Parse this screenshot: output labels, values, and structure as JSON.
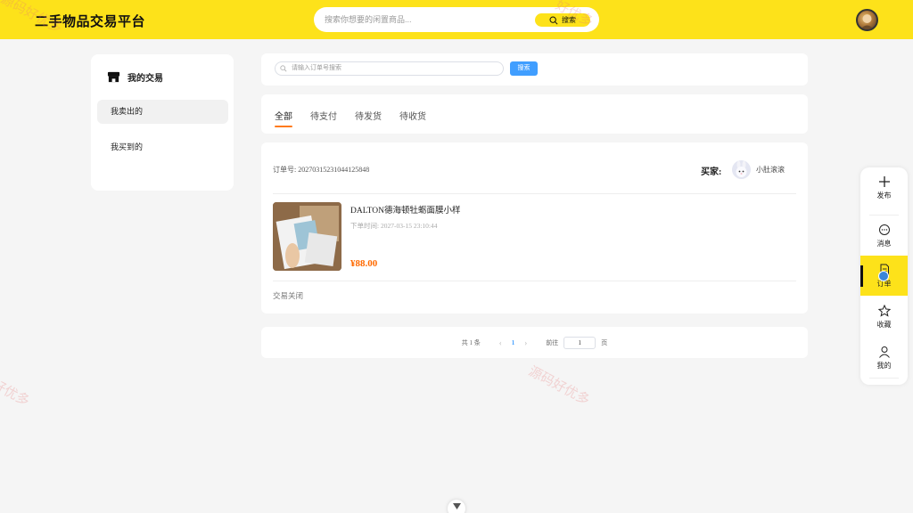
{
  "header": {
    "site_title": "二手物品交易平台",
    "search_placeholder": "搜索你想要的闲置商品...",
    "search_button": "搜索"
  },
  "watermarks": [
    "源码好优多",
    "好优多",
    "好优多",
    "源码好优多"
  ],
  "sidebar": {
    "title": "我的交易",
    "items": [
      {
        "label": "我卖出的",
        "active": true
      },
      {
        "label": "我买到的",
        "active": false
      }
    ]
  },
  "order_search": {
    "placeholder": "请输入订单号搜索",
    "button": "搜索"
  },
  "tabs": [
    {
      "label": "全部",
      "active": true
    },
    {
      "label": "待支付",
      "active": false
    },
    {
      "label": "待发货",
      "active": false
    },
    {
      "label": "待收货",
      "active": false
    }
  ],
  "order": {
    "order_no": "订单号: 20270315231044125848",
    "buyer_label": "买家:",
    "buyer_name": "小肚滚滚",
    "product_name": "DALTON德海顿牡蛎面膜小样",
    "order_time": "下单时间: 2027-03-15 23:10:44",
    "price": "¥88.00",
    "status": "交易关闭"
  },
  "pagination": {
    "total": "共 1 条",
    "prev": "‹",
    "current_page": "1",
    "next": "›",
    "goto_label": "前往",
    "goto_value": "1",
    "page_unit": "页"
  },
  "floatbar": [
    {
      "label": "发布",
      "icon": "plus-icon"
    },
    {
      "label": "消息",
      "icon": "message-icon"
    },
    {
      "label": "订单",
      "icon": "order-icon",
      "active": true
    },
    {
      "label": "收藏",
      "icon": "star-icon"
    },
    {
      "label": "我的",
      "icon": "user-icon"
    }
  ],
  "colors": {
    "brand_yellow": "#fde21a",
    "accent_orange": "#ff6a00",
    "link_blue": "#409eff"
  }
}
